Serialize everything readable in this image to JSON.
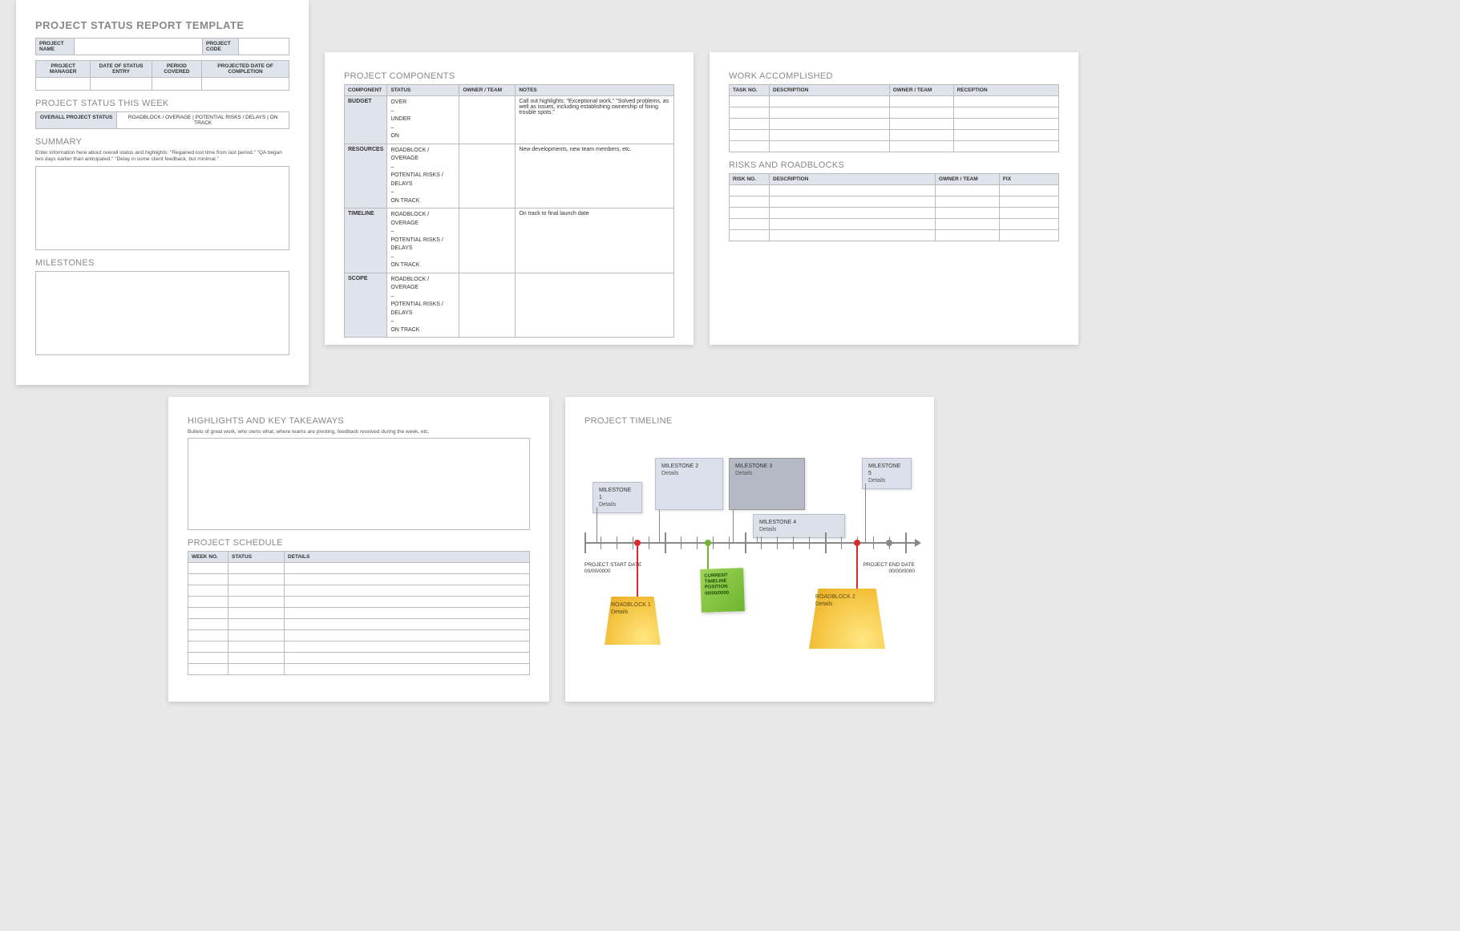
{
  "page1": {
    "title": "PROJECT STATUS REPORT TEMPLATE",
    "header_labels": {
      "project_name": "PROJECT NAME",
      "project_code": "PROJECT CODE",
      "project_manager": "PROJECT MANAGER",
      "date_status_entry": "DATE OF STATUS ENTRY",
      "period_covered": "PERIOD COVERED",
      "projected_completion": "PROJECTED DATE OF COMPLETION"
    },
    "status_section": "PROJECT STATUS THIS WEEK",
    "overall_label": "OVERALL PROJECT STATUS",
    "overall_options": "ROADBLOCK / OVERAGE   |   POTENTIAL RISKS / DELAYS   |   ON TRACK",
    "summary_heading": "SUMMARY",
    "summary_hint": "Enter information here about overall status and highlights: \"Regained lost time from last period.\" \"QA began two days earlier than anticipated.\" \"Delay in some client feedback, but minimal.\"",
    "milestones_heading": "MILESTONES"
  },
  "page2": {
    "title": "PROJECT COMPONENTS",
    "columns": [
      "COMPONENT",
      "STATUS",
      "OWNER / TEAM",
      "NOTES"
    ],
    "rows": [
      {
        "component": "BUDGET",
        "status": "OVER\n–\nUNDER\n–\nON",
        "notes": "Call out highlights: \"Exceptional work,\" \"Solved problems, as well as issues, including establishing ownership of fixing trouble spots.\""
      },
      {
        "component": "RESOURCES",
        "status": "ROADBLOCK / OVERAGE\n–\nPOTENTIAL RISKS / DELAYS\n–\nON TRACK",
        "notes": "New developments, new team members, etc."
      },
      {
        "component": "TIMELINE",
        "status": "ROADBLOCK / OVERAGE\n–\nPOTENTIAL RISKS / DELAYS\n–\nON TRACK",
        "notes": "On track to final launch date"
      },
      {
        "component": "SCOPE",
        "status": "ROADBLOCK / OVERAGE\n–\nPOTENTIAL RISKS / DELAYS\n–\nON TRACK",
        "notes": ""
      }
    ]
  },
  "page3": {
    "work_title": "WORK ACCOMPLISHED",
    "work_columns": [
      "TASK NO.",
      "DESCRIPTION",
      "OWNER / TEAM",
      "RECEPTION"
    ],
    "risks_title": "RISKS AND ROADBLOCKS",
    "risks_columns": [
      "RISK NO.",
      "DESCRIPTION",
      "OWNER / TEAM",
      "FIX"
    ]
  },
  "page4": {
    "highlights_title": "HIGHLIGHTS AND KEY TAKEAWAYS",
    "highlights_hint": "Bullets of great work, who owns what, where teams are pivoting, feedback received during the week, etc.",
    "schedule_title": "PROJECT SCHEDULE",
    "schedule_columns": [
      "WEEK NO.",
      "STATUS",
      "DETAILS"
    ]
  },
  "page5": {
    "title": "PROJECT TIMELINE",
    "milestones": [
      {
        "title": "MILESTONE 1",
        "detail": "Details"
      },
      {
        "title": "MILESTONE 2",
        "detail": "Details"
      },
      {
        "title": "MILESTONE 3",
        "detail": "Details"
      },
      {
        "title": "MILESTONE 4",
        "detail": "Details"
      },
      {
        "title": "MILESTONE 5",
        "detail": "Details"
      }
    ],
    "start_label": "PROJECT START DATE",
    "start_date": "00/00/0000",
    "end_label": "PROJECT END DATE",
    "end_date": "00/00/0000",
    "current_l1": "CURRENT",
    "current_l2": "TIMELINE",
    "current_l3": "POSITION",
    "current_l4": "00/00/0000",
    "roadblocks": [
      {
        "title": "ROADBLOCK 1",
        "detail": "Details"
      },
      {
        "title": "ROADBLOCK 2",
        "detail": "Details"
      }
    ]
  }
}
